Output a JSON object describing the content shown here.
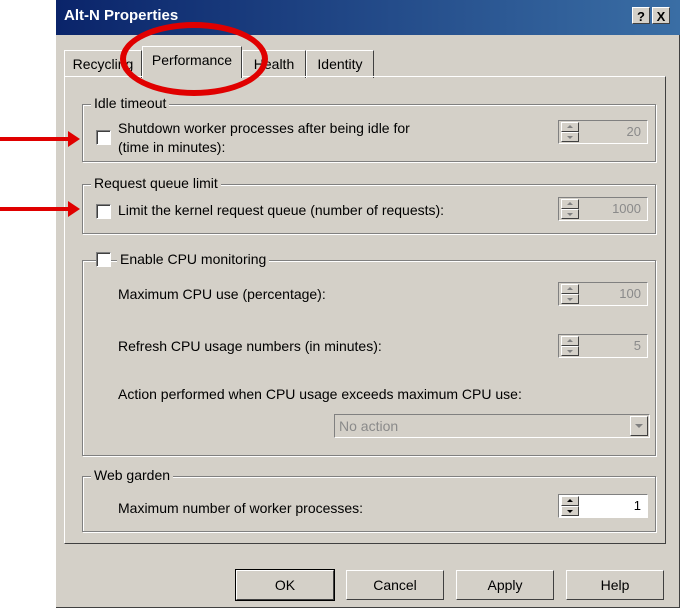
{
  "window": {
    "title": "Alt-N Properties"
  },
  "titlebar": {
    "help": "?",
    "close": "X"
  },
  "tabs": [
    {
      "label": "Recycling"
    },
    {
      "label": "Performance"
    },
    {
      "label": "Health"
    },
    {
      "label": "Identity"
    }
  ],
  "idle": {
    "legend": "Idle timeout",
    "label_line1": "Shutdown worker processes after being idle for",
    "label_line2": "(time in minutes):",
    "value": "20"
  },
  "queue": {
    "legend": "Request queue limit",
    "label": "Limit the kernel request queue (number of requests):",
    "value": "1000"
  },
  "cpu": {
    "legend": "Enable CPU monitoring",
    "max_label": "Maximum CPU use (percentage):",
    "max_value": "100",
    "refresh_label": "Refresh CPU usage numbers (in minutes):",
    "refresh_value": "5",
    "action_label": "Action performed when CPU usage exceeds maximum CPU use:",
    "action_value": "No action"
  },
  "garden": {
    "legend": "Web garden",
    "label": "Maximum number of worker processes:",
    "value": "1"
  },
  "buttons": {
    "ok": "OK",
    "cancel": "Cancel",
    "apply": "Apply",
    "help": "Help"
  },
  "colors": {
    "titlebar": "#0a246a",
    "annotation": "#e00000",
    "face": "#d4d0c8"
  }
}
